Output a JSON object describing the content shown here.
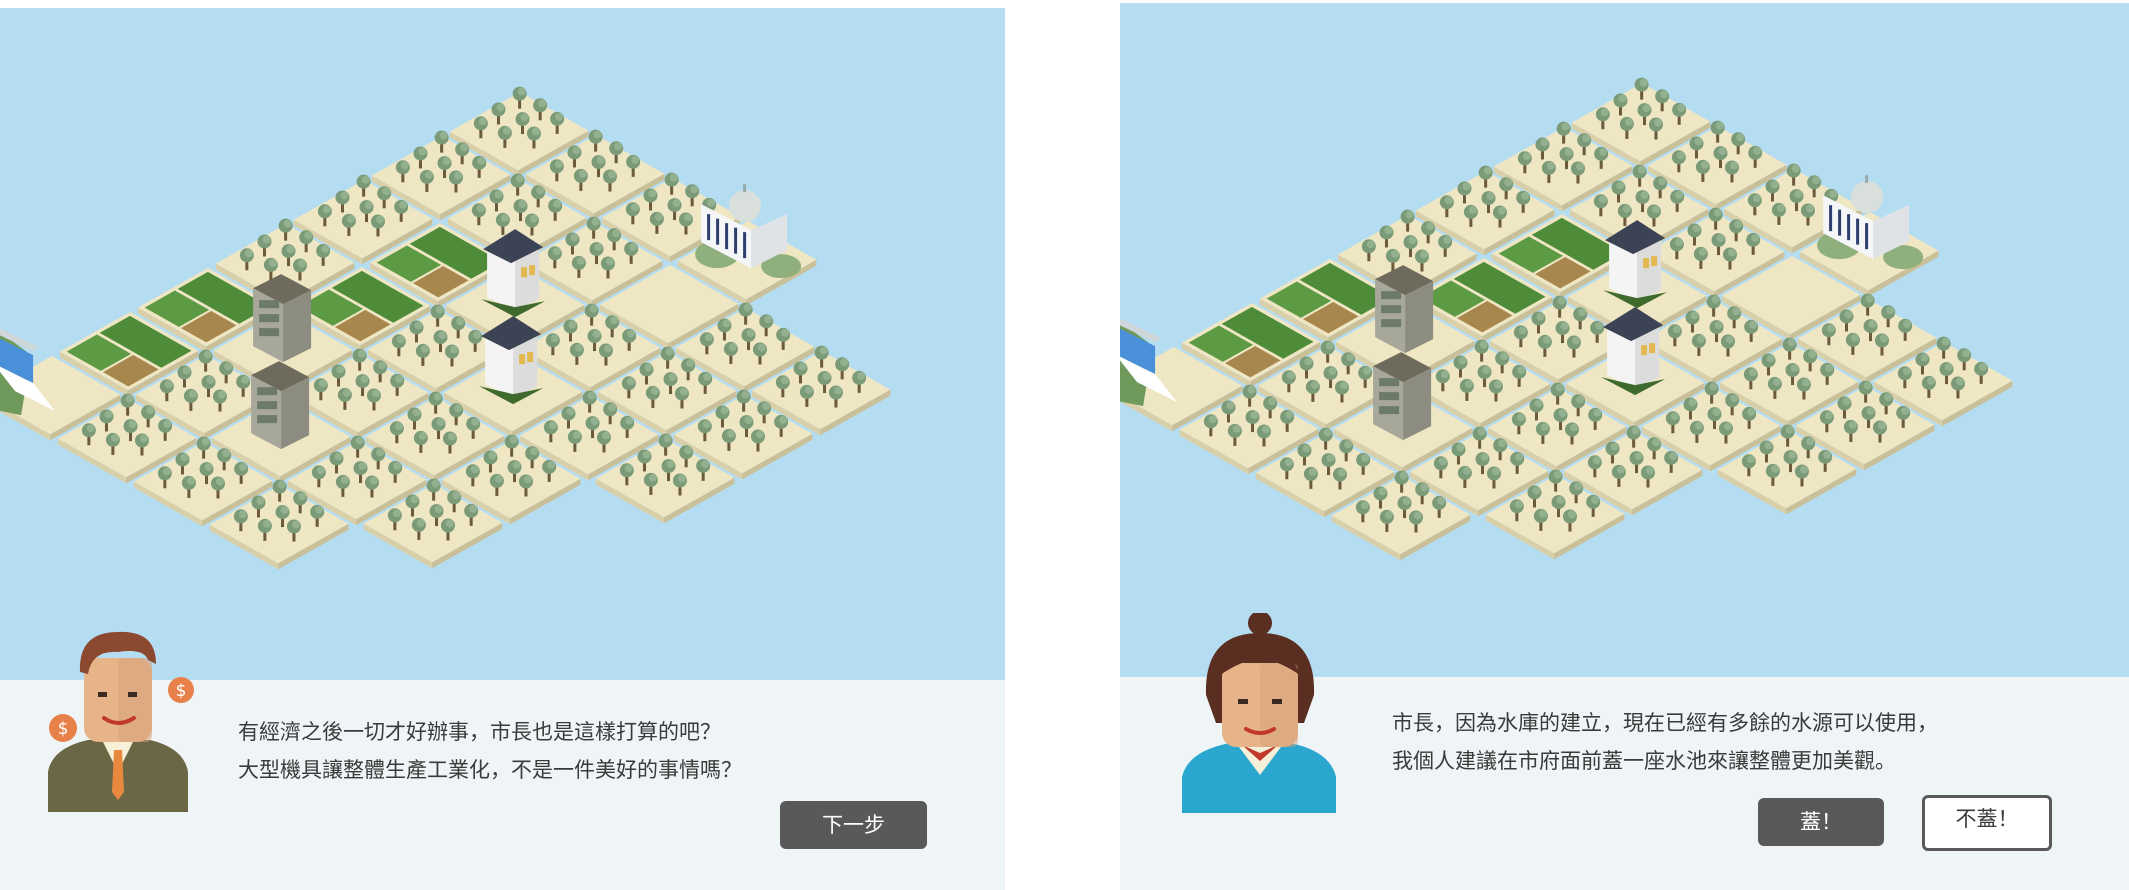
{
  "scene_left": {
    "dialog": {
      "speaker": "businessman-advisor",
      "line1": "有經濟之後一切才好辦事，市長也是這樣打算的吧？",
      "line2": "大型機具讓整體生產工業化，不是一件美好的事情嗎？",
      "next_label": "下一步"
    }
  },
  "scene_right": {
    "dialog": {
      "speaker": "citizen-woman",
      "line1": "市長，因為水庫的建立，現在已經有多餘的水源可以使用，",
      "line2": "我個人建議在市府面前蓋一座水池來讓整體更加美觀。",
      "build_label": "蓋！",
      "decline_label": "不蓋！"
    }
  },
  "colors": {
    "sky": "#b4ddf2",
    "dialog_bg": "#eff5f7",
    "tile": "#efe6c4",
    "tree": "#7a9a78",
    "farm": "#4e8c3a",
    "button_dark": "#595959"
  },
  "icons": [
    "dollar-coin-icon",
    "dam-icon",
    "city-hall-icon",
    "house-icon",
    "factory-icon",
    "tree-icon",
    "farm-field-icon"
  ]
}
